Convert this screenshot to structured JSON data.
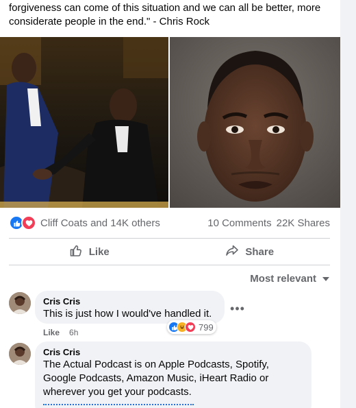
{
  "post": {
    "text": "forgiveness can come of this situation and we can all be better, more considerate people in the end.\" - Chris Rock"
  },
  "reactions": {
    "icons": [
      "like-icon",
      "love-icon"
    ],
    "summary": "Cliff Coats and 14K others",
    "comments": "10 Comments",
    "shares": "22K Shares"
  },
  "actions": {
    "like": "Like",
    "share": "Share"
  },
  "sort": {
    "label": "Most relevant"
  },
  "comments": [
    {
      "author": "Cris Cris",
      "text": "This is just how I would've handled it.",
      "reaction_icons": [
        "like-icon",
        "haha-icon",
        "love-icon"
      ],
      "reaction_count": "799",
      "like_label": "Like",
      "time": "6h"
    },
    {
      "author": "Cris Cris",
      "text": "The Actual Podcast is on Apple Podcasts, Spotify, Google Podcasts, Amazon Music, iHeart Radio or wherever you get your podcasts."
    }
  ],
  "colors": {
    "facebook_blue": "#1877f2",
    "love_red": "#f33e58",
    "haha_yellow": "#f7b125",
    "secondary_text": "#65676b",
    "bubble_bg": "#f0f2f5"
  }
}
